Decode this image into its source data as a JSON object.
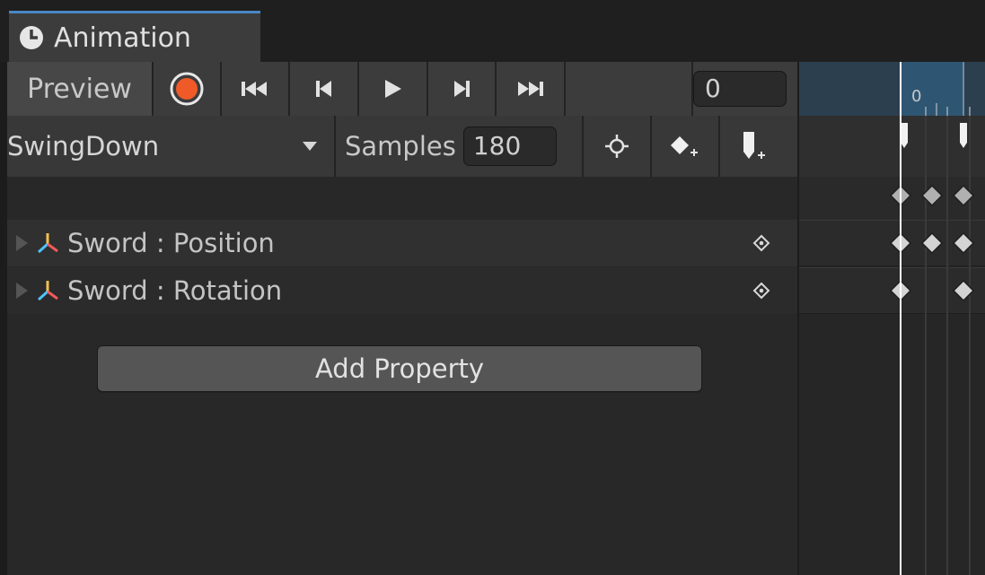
{
  "window": {
    "tab_title": "Animation",
    "tab_icon": "clock-icon",
    "accent": "#4a86c4"
  },
  "toolbar": {
    "preview_label": "Preview",
    "record_color": "#f05a28",
    "current_frame": "0",
    "buttons": [
      "record-icon",
      "first-key-icon",
      "previous-key-icon",
      "play-icon",
      "next-key-icon",
      "last-key-icon"
    ]
  },
  "clip_bar": {
    "clip_name": "SwingDown",
    "samples_label": "Samples",
    "samples_value": "180",
    "icons": [
      "filter-by-selection-icon",
      "add-keyframe-icon",
      "add-event-icon"
    ]
  },
  "properties": [
    {
      "label": "Sword : Position",
      "icon": "transform-axis-icon"
    },
    {
      "label": "Sword : Rotation",
      "icon": "transform-axis-icon"
    }
  ],
  "add_property_label": "Add Property",
  "timeline": {
    "ruler_label": "0",
    "playhead_color": "#ffffff"
  }
}
